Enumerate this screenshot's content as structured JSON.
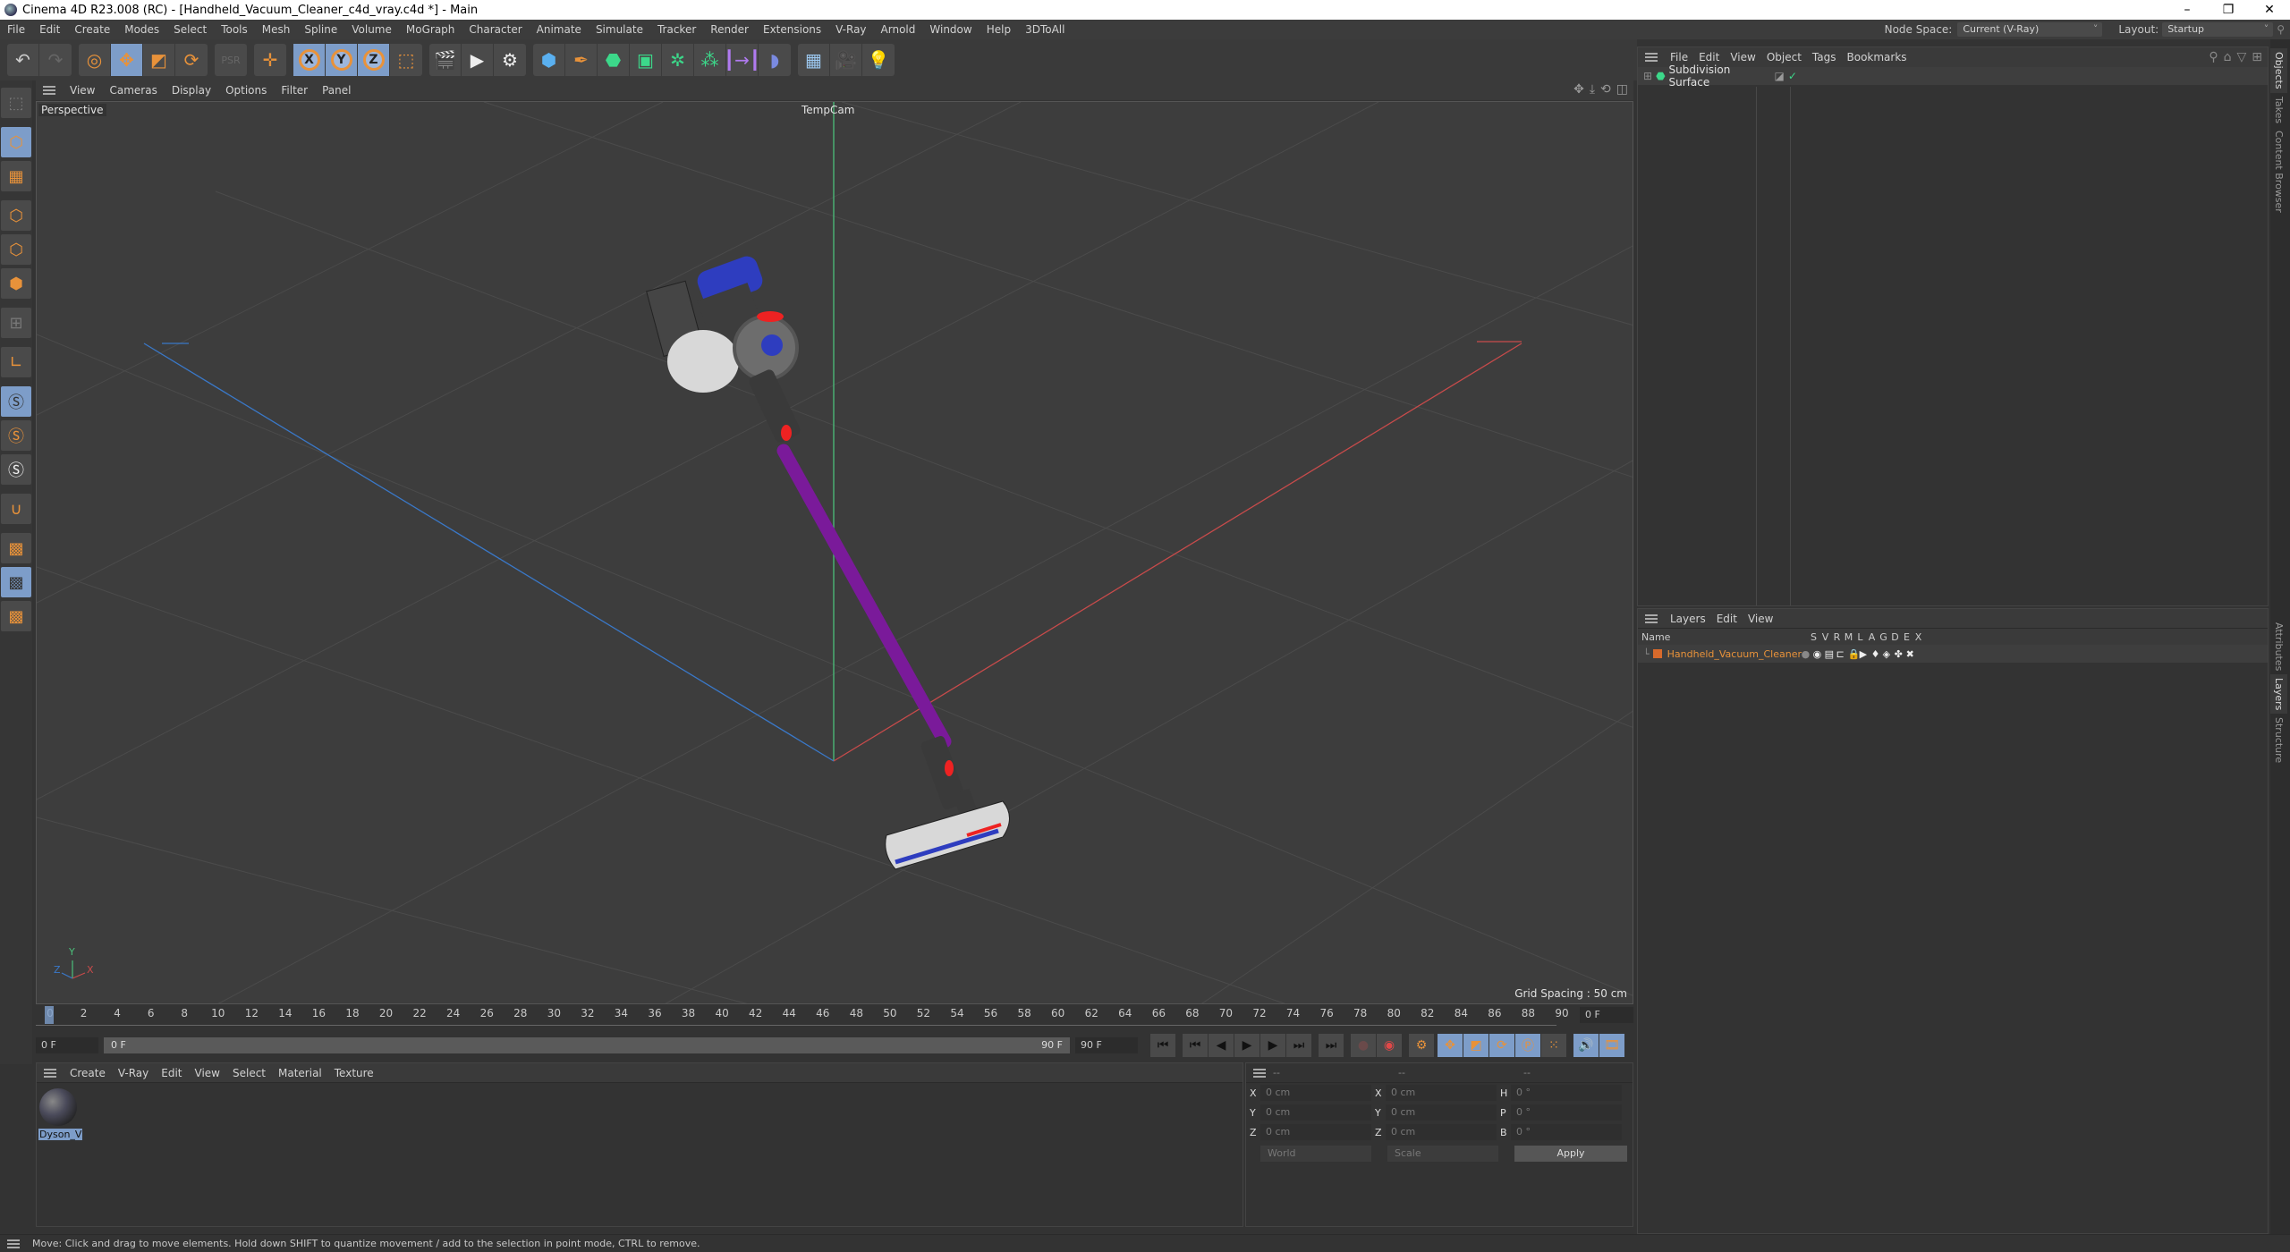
{
  "window": {
    "title": "Cinema 4D R23.008 (RC) - [Handheld_Vacuum_Cleaner_c4d_vray.c4d *] - Main",
    "controls": [
      "–",
      "❐",
      "✕"
    ]
  },
  "menubar": {
    "items": [
      "File",
      "Edit",
      "Create",
      "Modes",
      "Select",
      "Tools",
      "Mesh",
      "Spline",
      "Volume",
      "MoGraph",
      "Character",
      "Animate",
      "Simulate",
      "Tracker",
      "Render",
      "Extensions",
      "V-Ray",
      "Arnold",
      "Window",
      "Help",
      "3DToAll"
    ],
    "node_space_label": "Node Space:",
    "node_space_value": "Current (V-Ray)",
    "layout_label": "Layout:",
    "layout_value": "Startup"
  },
  "toolbar": {
    "groups": [
      [
        "undo-icon",
        "redo-icon"
      ],
      [
        "select-icon",
        "move-icon",
        "scale-icon",
        "rotate-icon"
      ],
      [
        "psr-icon"
      ],
      [
        "live-move-icon"
      ],
      [
        "x-axis-icon",
        "y-axis-icon",
        "z-axis-icon",
        "coordinate-system-icon"
      ],
      [
        "render-view-icon",
        "render-picture-viewer-icon",
        "render-settings-icon"
      ],
      [
        "cube-icon",
        "pen-icon",
        "subdivision-icon",
        "extrude-icon",
        "mograph-cloner-icon",
        "array-icon",
        "deformer-icon",
        "field-icon"
      ],
      [
        "floor-icon",
        "camera-icon",
        "light-icon"
      ]
    ],
    "axis_labels": [
      "X",
      "Y",
      "Z"
    ]
  },
  "left_tools": [
    "make-editable-icon",
    "model-mode-icon",
    "texture-mode-icon",
    "point-mode-icon",
    "edge-mode-icon",
    "polygon-mode-icon",
    "uv-mode-icon",
    "axis-mode-icon",
    "snap-icon",
    "snap-settings-icon",
    "quantize-icon",
    "magnet-icon",
    "workplane-icon",
    "locked-workplane-icon",
    "planar-workplane-icon"
  ],
  "viewport": {
    "menu": [
      "View",
      "Cameras",
      "Display",
      "Options",
      "Filter",
      "Panel"
    ],
    "view_name": "Perspective",
    "camera": "TempCam",
    "grid_spacing": "Grid Spacing : 50 cm",
    "axis_gizmo": {
      "x": "X",
      "y": "Y",
      "z": "Z"
    }
  },
  "timeline": {
    "ticks": [
      0,
      2,
      4,
      6,
      8,
      10,
      12,
      14,
      16,
      18,
      20,
      22,
      24,
      26,
      28,
      30,
      32,
      34,
      36,
      38,
      40,
      42,
      44,
      46,
      48,
      50,
      52,
      54,
      56,
      58,
      60,
      62,
      64,
      66,
      68,
      70,
      72,
      74,
      76,
      78,
      80,
      82,
      84,
      86,
      88,
      90
    ],
    "current_frame": "0 F",
    "start_field": "0 F",
    "slider_start": "0 F",
    "slider_end": "90 F",
    "end_field": "90 F",
    "max": 90
  },
  "material_panel": {
    "menu": [
      "Create",
      "V-Ray",
      "Edit",
      "View",
      "Select",
      "Material",
      "Texture"
    ],
    "materials": [
      {
        "name": "Dyson_V"
      }
    ]
  },
  "coord_panel": {
    "headers": [
      "--",
      "--",
      "--"
    ],
    "rows": [
      {
        "a": "X",
        "av": "0 cm",
        "b": "X",
        "bv": "0 cm",
        "c": "H",
        "cv": "0 °"
      },
      {
        "a": "Y",
        "av": "0 cm",
        "b": "Y",
        "bv": "0 cm",
        "c": "P",
        "cv": "0 °"
      },
      {
        "a": "Z",
        "av": "0 cm",
        "b": "Z",
        "bv": "0 cm",
        "c": "B",
        "cv": "0 °"
      }
    ],
    "space": "World",
    "mode": "Scale",
    "apply": "Apply"
  },
  "objects_panel": {
    "menu": [
      "File",
      "Edit",
      "View",
      "Object",
      "Tags",
      "Bookmarks"
    ],
    "objects": [
      {
        "name": "Subdivision Surface"
      }
    ]
  },
  "layers_panel": {
    "menu": [
      "Layers",
      "Edit",
      "View"
    ],
    "name_col": "Name",
    "flag_cols": [
      "S",
      "V",
      "R",
      "M",
      "L",
      "A",
      "G",
      "D",
      "E",
      "X"
    ],
    "layers": [
      {
        "name": "Handheld_Vacuum_Cleaner",
        "color": "#d86a2c"
      }
    ]
  },
  "side_tabs_top": [
    "Objects",
    "Takes",
    "Content Browser"
  ],
  "side_tabs_bottom": [
    "Attributes",
    "Layers",
    "Structure"
  ],
  "status": "Move: Click and drag to move elements. Hold down SHIFT to quantize movement / add to the selection in point mode, CTRL to remove.",
  "colors": {
    "accent": "#e8923a",
    "selection": "#7d9dc9",
    "axis_x": "#c84b4b",
    "axis_y": "#4bbf7a",
    "axis_z": "#3a78c8",
    "vacuum_tube": "#7a1a9a"
  }
}
